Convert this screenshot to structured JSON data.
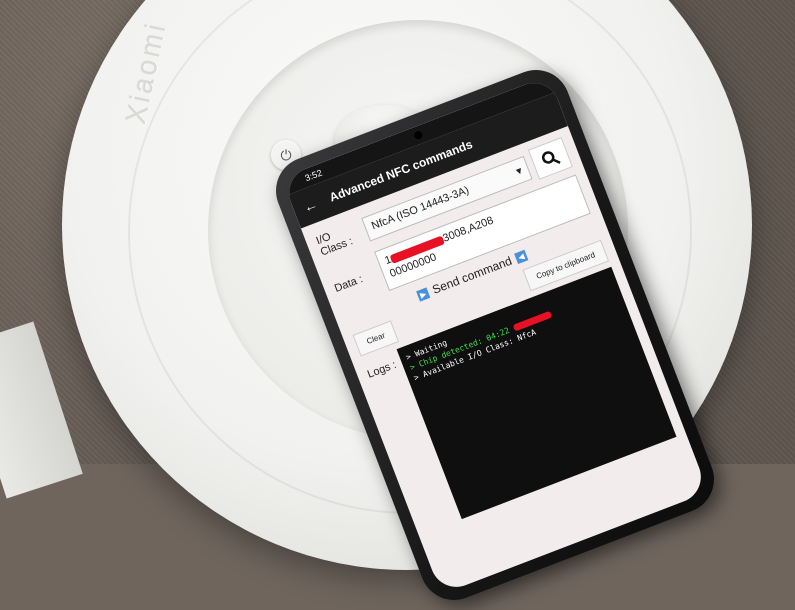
{
  "device": {
    "brand": "Xiaomi",
    "power_icon": "power-icon"
  },
  "phone": {
    "status_time": "3:52",
    "app_title": "Advanced NFC commands",
    "io_class_label": "I/O Class :",
    "io_class_value": "NfcA (ISO 14443-3A)",
    "data_label": "Data :",
    "data_line1_prefix": "1",
    "data_line1_suffix": "3008,A208",
    "data_line2": "00000000",
    "send_command_label": "Send command",
    "clear_label": "Clear",
    "copy_label": "Copy to clipboard",
    "logs_label": "Logs :",
    "logs": {
      "line1": "> Waiting",
      "line2_prefix": "> Chip detected: 04:22",
      "line3": "> Available I/O Class: NfcA"
    }
  },
  "colors": {
    "redaction": "#e81123",
    "log_green": "#3fe04a",
    "appbar": "#1c1c1c"
  }
}
